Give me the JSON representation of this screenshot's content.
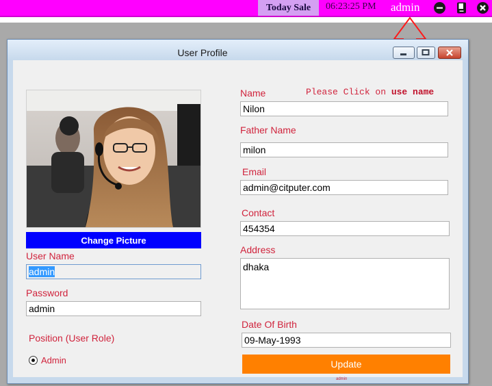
{
  "topbar": {
    "today_sale": "Today Sale",
    "clock": "06:23:25 PM",
    "user": "admin",
    "icons": [
      "minimize-icon",
      "book-icon",
      "close-icon"
    ],
    "bg_color": "#ff00ff"
  },
  "window": {
    "title": "User Profile",
    "buttons": [
      "minimize-icon",
      "maximize-icon",
      "close-icon"
    ]
  },
  "hint": {
    "prefix": "Please Click on ",
    "bold": "use name"
  },
  "profile": {
    "change_picture": "Change Picture",
    "username_label": "User Name",
    "username_value": "admin",
    "password_label": "Password",
    "password_value": "admin",
    "position_label": "Position (User Role)",
    "role_option": "Admin",
    "role_selected": true
  },
  "details": {
    "name_label": "Name",
    "name_value": "Nilon",
    "father_label": "Father Name",
    "father_value": "milon",
    "email_label": "Email",
    "email_value": "admin@citputer.com",
    "contact_label": "Contact",
    "contact_value": "454354",
    "address_label": "Address",
    "address_value": "dhaka",
    "dob_label": "Date Of Birth",
    "dob_value": "09-May-1993",
    "update_label": "Update",
    "footer_user": "admin"
  },
  "colors": {
    "label": "#d0233c",
    "change_button": "#0000ff",
    "update_button": "#ff8000",
    "selection": "#3399ff"
  }
}
